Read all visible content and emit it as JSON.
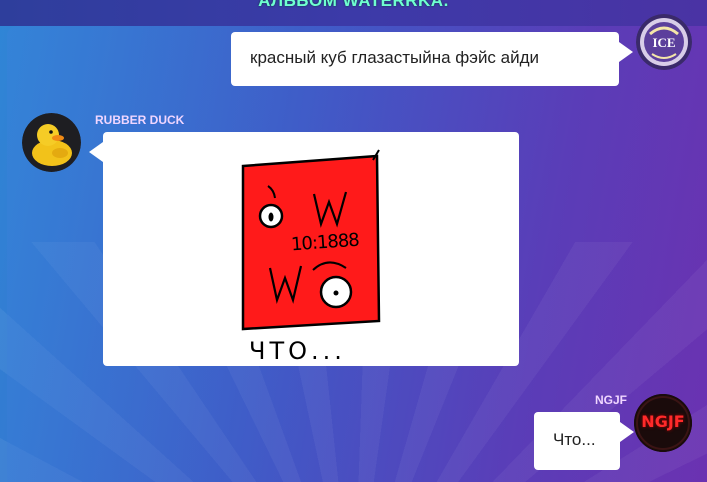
{
  "header": {
    "title": "АЛЬБОМ WATERRKA."
  },
  "messages": [
    {
      "id": "m1",
      "side": "right",
      "text": "красный куб глазастыйна фэйс айди"
    },
    {
      "id": "m2",
      "side": "left",
      "sender": "RUBBER DUCK",
      "type": "image",
      "drawing_text": {
        "clock": "10:1888",
        "caption": "ЧТО..."
      }
    },
    {
      "id": "m3",
      "side": "right",
      "sender": "NGJF",
      "text": "Что...",
      "avatar_text": "NGJF"
    }
  ],
  "colors": {
    "accent_title": "#6fffd0",
    "sender_name": "#f0d6ff",
    "drawing_red": "#ff1a1a",
    "ngjf_red": "#ff2a2a"
  }
}
